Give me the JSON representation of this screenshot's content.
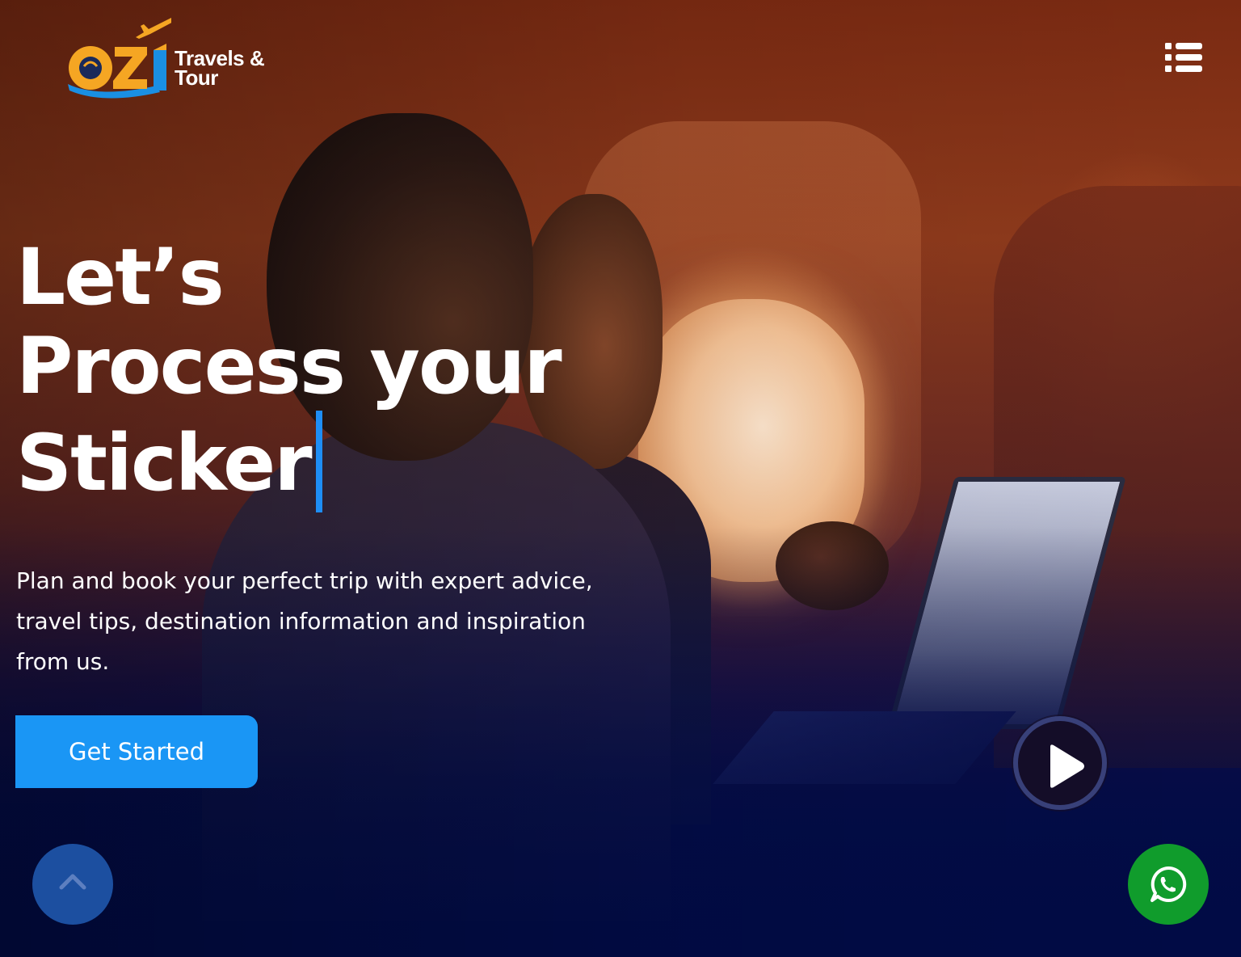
{
  "brand": {
    "logo_mark_text": "OZI",
    "name_line1": "Travels &",
    "name_line2": "Tour",
    "colors": {
      "logo_orange": "#f5a623",
      "logo_blue": "#1a8fe3"
    }
  },
  "nav": {
    "menu_icon": "list-menu-icon"
  },
  "hero": {
    "headline_line1": "Let’s",
    "headline_line2": "Process your",
    "headline_line3": "Sticker",
    "subtext": "Plan and book your perfect trip with expert advice, travel tips, destination information and inspiration from us.",
    "cta_label": "Get Started",
    "play_icon": "play-icon"
  },
  "floating": {
    "scroll_top_icon": "chevron-up-icon",
    "whatsapp_icon": "whatsapp-icon"
  },
  "colors": {
    "accent": "#1a96f5",
    "caret": "#1e8ef5",
    "whatsapp": "#109c2c",
    "scroll_top": "#1c4fa0",
    "bottom_navy": "#010b45"
  }
}
